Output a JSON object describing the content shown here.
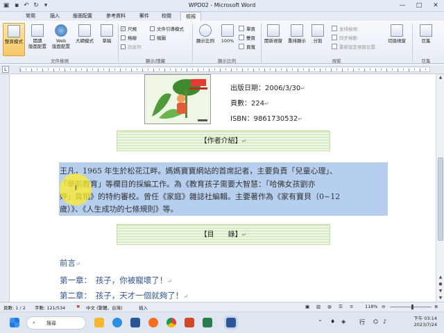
{
  "window": {
    "title": "WPD02 - Microsoft Word"
  },
  "tabs": [
    "常用",
    "插入",
    "版面配置",
    "參考資料",
    "郵件",
    "校閱",
    "檢視"
  ],
  "ribbon": {
    "groups": {
      "doc_views": {
        "label": "文件檢視",
        "buttons": [
          "整頁模式",
          "閱讀\n版面配置",
          "Web\n版面配置",
          "大綱模式",
          "草稿"
        ]
      },
      "show_hide": {
        "label": "顯示/隱藏",
        "checks": [
          {
            "label": "尺規",
            "checked": true
          },
          {
            "label": "文件引導模式",
            "checked": false
          },
          {
            "label": "格線",
            "checked": false
          },
          {
            "label": "縮圖",
            "checked": false
          },
          {
            "label": "訊息列",
            "checked": false
          }
        ]
      },
      "zoom": {
        "label": "顯示比例",
        "buttons": [
          "顯示比例",
          "100%"
        ],
        "small": [
          "單頁",
          "雙頁",
          "頁寬"
        ]
      },
      "window": {
        "label": "視窗",
        "buttons": [
          "開新視窗",
          "重排顯示",
          "分割"
        ],
        "small": [
          "並排檢視",
          "同步捲動",
          "重新設定視窗位置"
        ],
        "switch_label": "切換視窗"
      },
      "macros": {
        "label": "巨集",
        "buttons": [
          "巨集"
        ]
      }
    }
  },
  "document": {
    "pub_date": "出版日期：2006/3/30",
    "pages": "頁數：224",
    "isbn": "ISBN：9861730532",
    "author_header": "【作者介紹】",
    "author_lines": [
      "王凡，1965 年生於松花江畔。媽媽寶寶網站的首席記者，主要負責「兒童心理」、",
      "「學前教育」等欄目的採編工作。為《教育孩子需要大智慧：「哈佛女孩劉亦",
      "婷」真相》的特約審校。曾任《家庭》雜誌社編輯。主要著作為《家有寶貝（0~12",
      "歲）》、《人生成功的七條規則》等。"
    ],
    "toc_header": "【目　　錄】",
    "toc": [
      "前言",
      "第一章：　孩子，你被寵壞了！",
      "第二章：　孩子，天才一個就夠了！"
    ]
  },
  "status": {
    "page": "頁數: 1 / 2",
    "words": "字數: 121/534",
    "language": "中文 (繁體，台灣)",
    "mode": "插入",
    "zoom": "118%"
  },
  "taskbar": {
    "search": "搜尋",
    "ime": "行",
    "time": "下午 03:14",
    "date": "2023/7/24"
  },
  "colors": {
    "ribbon_bg": "#e7edf6",
    "highlight": "#b7cfee",
    "banner": "#d9ebc4",
    "toc_text": "#33568f",
    "cursor_halo": "#ffec28"
  }
}
